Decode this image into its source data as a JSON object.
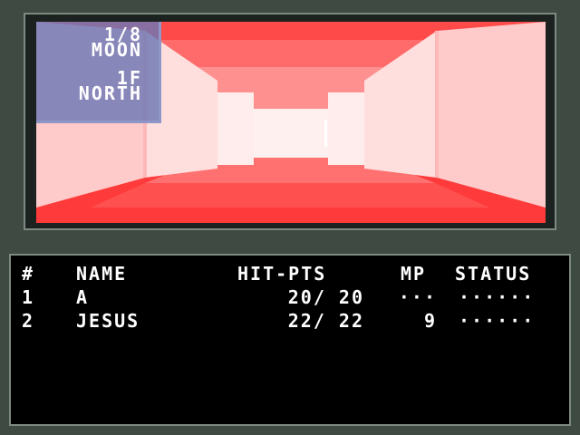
{
  "location": {
    "day": "1/8",
    "moon": "MOON",
    "floor": "1F",
    "direction": "NORTH"
  },
  "party": {
    "headers": {
      "num": "#",
      "name": "NAME",
      "hp": "HIT-PTS",
      "mp": "MP",
      "status": "STATUS"
    },
    "members": [
      {
        "num": "1",
        "name": "A",
        "hp": "20/ 20",
        "mp": "···",
        "status": "······"
      },
      {
        "num": "2",
        "name": "JESUS",
        "hp": "22/ 22",
        "mp": "9",
        "status": "······"
      }
    ]
  },
  "colors": {
    "background": "#3e4a42",
    "ceiling": "#ff4a4a",
    "floor": "#ff3a3a",
    "wall": "#ffd0d0",
    "panel": "#000000",
    "text": "#ffffff"
  }
}
